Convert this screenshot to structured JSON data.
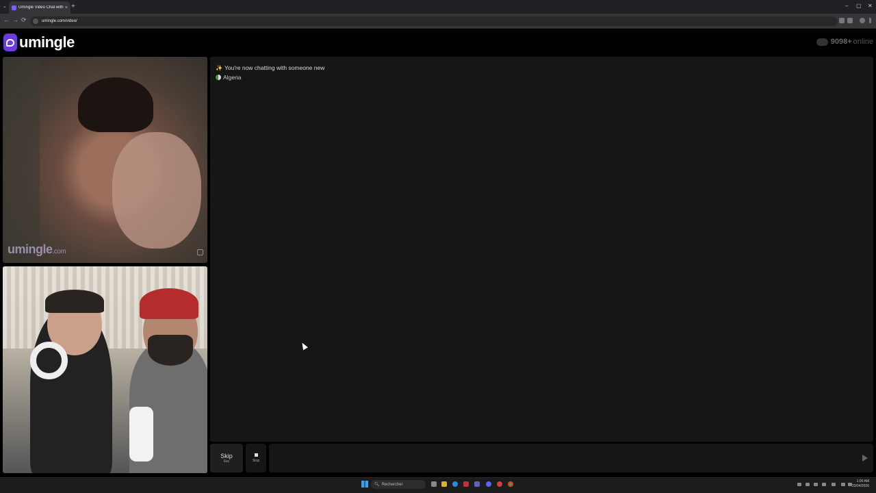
{
  "browser": {
    "tab_title": "Umingle Video Chat with S",
    "tab_close": "×",
    "new_tab": "+",
    "tab_menu": "⌄",
    "url": "umingle.com/video/",
    "back": "←",
    "forward": "→",
    "reload": "⟳",
    "minimize": "–",
    "maximize": "▢",
    "close": "✕"
  },
  "page": {
    "logo_text": "umingle",
    "online_count": "9098+",
    "online_label": "online",
    "watermark": "umingle",
    "watermark_suffix": ".com"
  },
  "chat": {
    "status_icon": "✨",
    "status_text": "You're now chatting with someone new",
    "country": "Algeria"
  },
  "controls": {
    "skip_label": "Skip",
    "skip_key": "Esc",
    "stop_label": "Stop",
    "message_placeholder": ""
  },
  "taskbar": {
    "search_placeholder": "Rechercher",
    "time": "1:00 AM",
    "date": "23/04/2026"
  },
  "colors": {
    "brand": "#6c3ce0",
    "background": "#000000",
    "panel": "#161616"
  }
}
